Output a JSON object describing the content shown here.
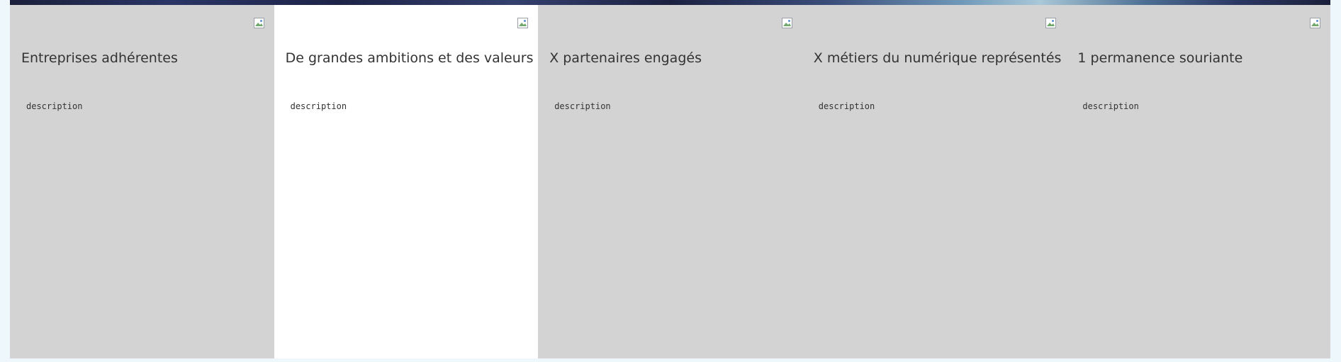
{
  "cards": [
    {
      "title": "Entreprises adhérentes",
      "description": "description",
      "icon": "broken-image-icon"
    },
    {
      "title": "De grandes ambitions et des valeurs",
      "description": "description",
      "icon": "broken-image-icon"
    },
    {
      "title": "X partenaires engagés",
      "description": "description",
      "icon": "broken-image-icon"
    },
    {
      "title": "X métiers du numérique représentés",
      "description": "description",
      "icon": "broken-image-icon"
    },
    {
      "title": "1 permanence souriante",
      "description": "description",
      "icon": "broken-image-icon"
    }
  ],
  "colors": {
    "card_background": "#d3d3d3",
    "active_card_background": "#ffffff",
    "page_background": "#eef7fb",
    "text": "#333333"
  }
}
